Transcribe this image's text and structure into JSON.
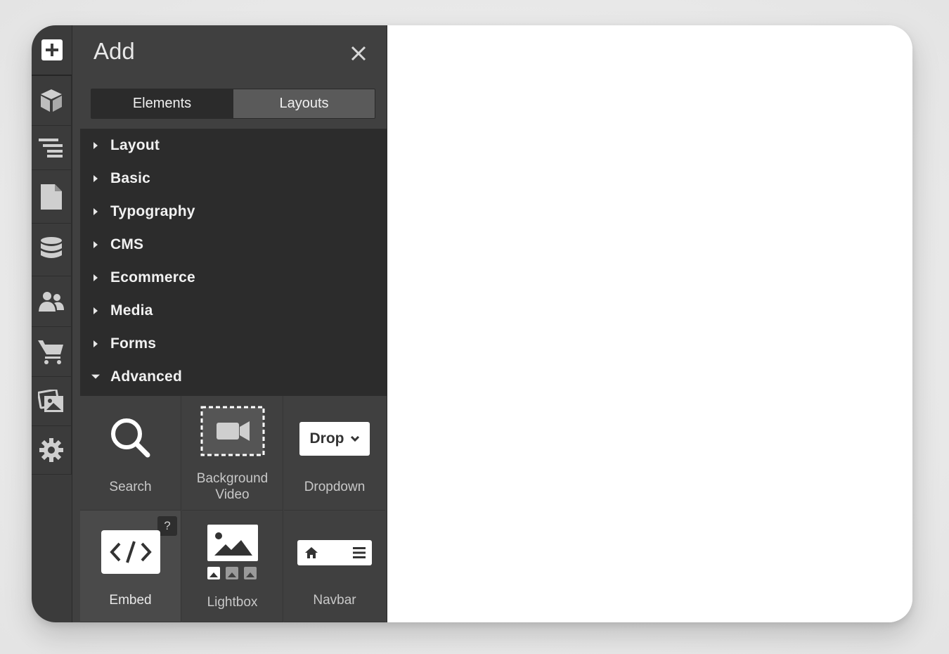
{
  "panel": {
    "title": "Add",
    "tabs": [
      {
        "label": "Elements",
        "active": true
      },
      {
        "label": "Layouts",
        "active": false
      }
    ]
  },
  "rail": {
    "items": [
      {
        "icon": "plus-icon",
        "name": "add"
      },
      {
        "icon": "cube-icon",
        "name": "components"
      },
      {
        "icon": "navigator-icon",
        "name": "navigator"
      },
      {
        "icon": "page-icon",
        "name": "pages"
      },
      {
        "icon": "database-icon",
        "name": "cms"
      },
      {
        "icon": "users-icon",
        "name": "users"
      },
      {
        "icon": "cart-icon",
        "name": "ecommerce"
      },
      {
        "icon": "images-icon",
        "name": "assets"
      },
      {
        "icon": "gear-icon",
        "name": "settings"
      }
    ]
  },
  "categories": [
    {
      "label": "Layout",
      "expanded": false
    },
    {
      "label": "Basic",
      "expanded": false
    },
    {
      "label": "Typography",
      "expanded": false
    },
    {
      "label": "CMS",
      "expanded": false
    },
    {
      "label": "Ecommerce",
      "expanded": false
    },
    {
      "label": "Media",
      "expanded": false
    },
    {
      "label": "Forms",
      "expanded": false
    },
    {
      "label": "Advanced",
      "expanded": true
    }
  ],
  "elements": [
    {
      "label": "Search",
      "icon": "search-icon"
    },
    {
      "label": "Background\nVideo",
      "label_line1": "Background",
      "label_line2": "Video",
      "icon": "video-icon"
    },
    {
      "label": "Dropdown",
      "icon": "dropdown-icon",
      "preview_text": "Drop"
    },
    {
      "label": "Embed",
      "icon": "code-icon",
      "help": "?"
    },
    {
      "label": "Lightbox",
      "icon": "lightbox-icon"
    },
    {
      "label": "Navbar",
      "icon": "navbar-icon"
    }
  ],
  "colors": {
    "rail": "#3b3b3b",
    "panel": "#404040",
    "category_bg": "#2c2c2c",
    "text": "#f1f1f1"
  }
}
